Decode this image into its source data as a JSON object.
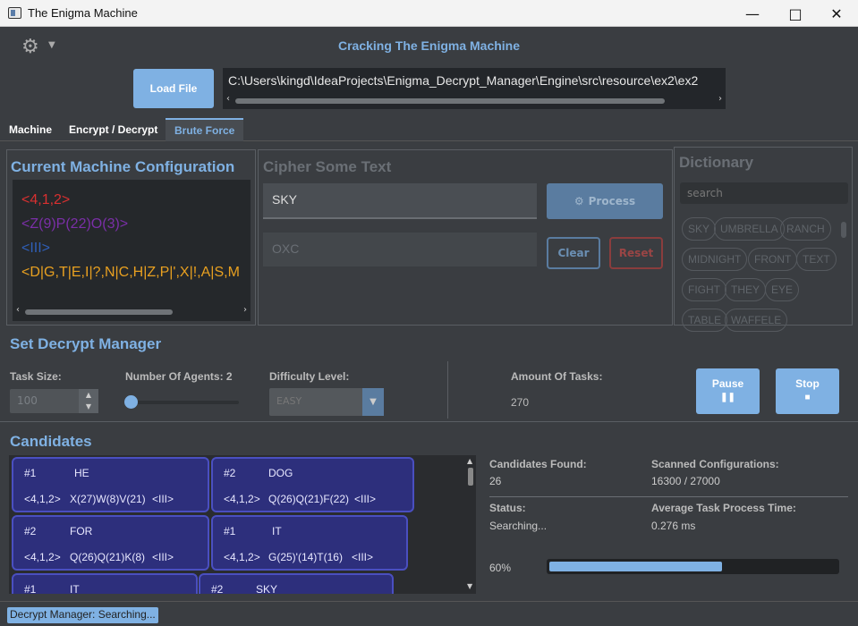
{
  "window": {
    "title": "The Enigma Machine",
    "controls": [
      "minimize",
      "maximize",
      "close"
    ]
  },
  "header": {
    "app_title": "Cracking The Enigma Machine",
    "load_file_label": "Load File",
    "file_path": "C:\\Users\\kingd\\IdeaProjects\\Enigma_Decrypt_Manager\\Engine\\src\\resource\\ex2\\ex2"
  },
  "tabs": [
    {
      "label": "Machine"
    },
    {
      "label": "Encrypt / Decrypt"
    },
    {
      "label": "Brute Force"
    }
  ],
  "machine_config": {
    "title": "Current Machine Configuration",
    "lines": [
      "<4,1,2>",
      "<Z(9)P(22)O(3)>",
      "<III>",
      "<D|G,T|E,I|?,N|C,H|Z,P|',X|!,A|S,M"
    ],
    "colors": [
      "#d93030",
      "#7b2fa8",
      "#2f5fb8",
      "#e8a020"
    ]
  },
  "cipher": {
    "title": "Cipher Some Text",
    "input_value": "SKY",
    "output_value": "OXC",
    "process_label": "Process",
    "clear_label": "Clear",
    "reset_label": "Reset"
  },
  "dictionary": {
    "title": "Dictionary",
    "search_placeholder": "search",
    "words": [
      "SKY",
      "UMBRELLA",
      "RANCH",
      "MIDNIGHT",
      "FRONT",
      "TEXT",
      "FIGHT",
      "THEY",
      "EYE",
      "TABLE",
      "WAFFELE"
    ]
  },
  "decrypt_manager": {
    "title": "Set Decrypt Manager",
    "task_size_label": "Task Size:",
    "task_size_value": "100",
    "agents_label": "Number Of Agents: 2",
    "agents_value": 2,
    "difficulty_label": "Difficulty Level:",
    "difficulty_value": "EASY",
    "amount_label": "Amount Of Tasks:",
    "amount_value": "270",
    "pause_label": "Pause",
    "stop_label": "Stop"
  },
  "candidates": {
    "title": "Candidates",
    "items": [
      {
        "id": "#1",
        "word": "HE",
        "pos": "<4,1,2>",
        "rotors": "X(27)W(8)V(21)",
        "reflector": "<III>"
      },
      {
        "id": "#2",
        "word": "DOG",
        "pos": "<4,1,2>",
        "rotors": "Q(26)Q(21)F(22)",
        "reflector": "<III>"
      },
      {
        "id": "#2",
        "word": "FOR",
        "pos": "<4,1,2>",
        "rotors": "Q(26)Q(21)K(8)",
        "reflector": "<III>"
      },
      {
        "id": "#1",
        "word": "IT",
        "pos": "<4,1,2>",
        "rotors": "G(25)'(14)T(16)",
        "reflector": "<III>"
      },
      {
        "id": "#1",
        "word": "IT",
        "pos": "",
        "rotors": "",
        "reflector": ""
      },
      {
        "id": "#2",
        "word": "SKY",
        "pos": "",
        "rotors": "",
        "reflector": ""
      }
    ],
    "found_label": "Candidates Found:",
    "found_value": "26",
    "scanned_label": "Scanned Configurations:",
    "scanned_value": "16300 / 27000",
    "status_label": "Status:",
    "status_value": "Searching...",
    "avg_label": "Average Task Process Time:",
    "avg_value": "0.276 ms",
    "progress_text": "60%",
    "progress_fraction": 0.6
  },
  "statusbar": {
    "text": "Decrypt Manager: Searching..."
  }
}
